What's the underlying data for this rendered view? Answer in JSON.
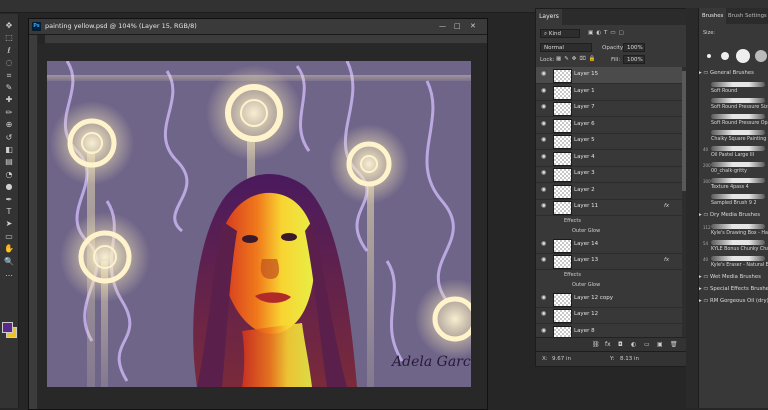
{
  "document": {
    "title": "painting yellow.psd @ 104% (Layer 15, RGB/8)",
    "app_icon": "Ps",
    "window_buttons": [
      "—",
      "□",
      "✕"
    ]
  },
  "artwork": {
    "signature": "Adela Garcia",
    "background_color": "#6f6589",
    "glow_color": "#f3e5b6"
  },
  "toolbar": {
    "icons": [
      "move-icon",
      "marquee-icon",
      "lasso-icon",
      "quick-select-icon",
      "crop-icon",
      "eyedropper-icon",
      "healing-icon",
      "brush-icon",
      "stamp-icon",
      "history-brush-icon",
      "eraser-icon",
      "gradient-icon",
      "blur-icon",
      "dodge-icon",
      "pen-icon",
      "type-icon",
      "path-select-icon",
      "shape-icon",
      "hand-icon",
      "zoom-icon",
      "edit-toolbar-icon"
    ],
    "glyphs": [
      "✥",
      "⬚",
      "ℓ",
      "◌",
      "⌗",
      "✎",
      "✚",
      "✏",
      "⊕",
      "↺",
      "◧",
      "▤",
      "◔",
      "●",
      "✒",
      "T",
      "➤",
      "▭",
      "✋",
      "🔍",
      "…"
    ],
    "foreground_color": "#5a2a8a",
    "background_color": "#f0c020"
  },
  "layers_panel": {
    "tab": "Layers",
    "filter_label": "Kind",
    "blend_mode": "Normal",
    "opacity_label": "Opacity:",
    "opacity_value": "100%",
    "lock_label": "Lock:",
    "fill_label": "Fill:",
    "fill_value": "100%",
    "layers": [
      {
        "name": "Layer 15",
        "selected": true,
        "fx": false
      },
      {
        "name": "Layer 1",
        "selected": false,
        "fx": false
      },
      {
        "name": "Layer 7",
        "selected": false,
        "fx": false
      },
      {
        "name": "Layer 6",
        "selected": false,
        "fx": false
      },
      {
        "name": "Layer 5",
        "selected": false,
        "fx": false
      },
      {
        "name": "Layer 4",
        "selected": false,
        "fx": false
      },
      {
        "name": "Layer 3",
        "selected": false,
        "fx": false
      },
      {
        "name": "Layer 2",
        "selected": false,
        "fx": false
      },
      {
        "name": "Layer 11",
        "selected": false,
        "fx": true
      },
      {
        "name": "Layer 14",
        "selected": false,
        "fx": false
      },
      {
        "name": "Layer 13",
        "selected": false,
        "fx": true
      },
      {
        "name": "Layer 12 copy",
        "selected": false,
        "fx": false
      },
      {
        "name": "Layer 12",
        "selected": false,
        "fx": false
      },
      {
        "name": "Layer 8",
        "selected": false,
        "fx": false
      }
    ],
    "effects_label": "Effects",
    "outer_glow_label": "Outer Glow",
    "fx_label": "fx",
    "footer_icons": [
      "link-icon",
      "fx-icon",
      "mask-icon",
      "adjustment-icon",
      "folder-icon",
      "new-layer-icon",
      "trash-icon"
    ],
    "footer_glyphs": [
      "⛓",
      "fx",
      "◘",
      "◐",
      "▭",
      "▣",
      "🗑"
    ]
  },
  "info_strip": {
    "x_label": "X:",
    "x_value": "9.67 in",
    "y_label": "Y:",
    "y_value": "8.13 in"
  },
  "brushes_panel": {
    "tabs": [
      "Brushes",
      "Brush Settings"
    ],
    "size_label": "Size:",
    "general_group": "General Brushes",
    "brushes": [
      {
        "name": "Soft Round",
        "size": ""
      },
      {
        "name": "Soft Round Pressure Size",
        "size": ""
      },
      {
        "name": "Soft Round Pressure Opacity",
        "size": ""
      },
      {
        "name": "Chalky Square Painting",
        "size": ""
      },
      {
        "name": "Oil Pastel Large III",
        "size": "40"
      },
      {
        "name": "00_chalk-gritty",
        "size": "200"
      },
      {
        "name": "Texture 4pass 4",
        "size": "300"
      },
      {
        "name": "Sampled Brush 9 2",
        "size": ""
      }
    ],
    "dry_media_group": "Dry Media Brushes",
    "dry_brushes": [
      {
        "name": "Kyle's Drawing Box - Happy",
        "size": "112"
      },
      {
        "name": "KYLE Bonus Chunky Charcoal",
        "size": "54"
      },
      {
        "name": "Kyle's Eraser - Natural Edge",
        "size": "40"
      }
    ],
    "other_groups": [
      "Wet Media Brushes",
      "Special Effects Brushes",
      "RM Gorgeous Oil (dry)"
    ]
  }
}
